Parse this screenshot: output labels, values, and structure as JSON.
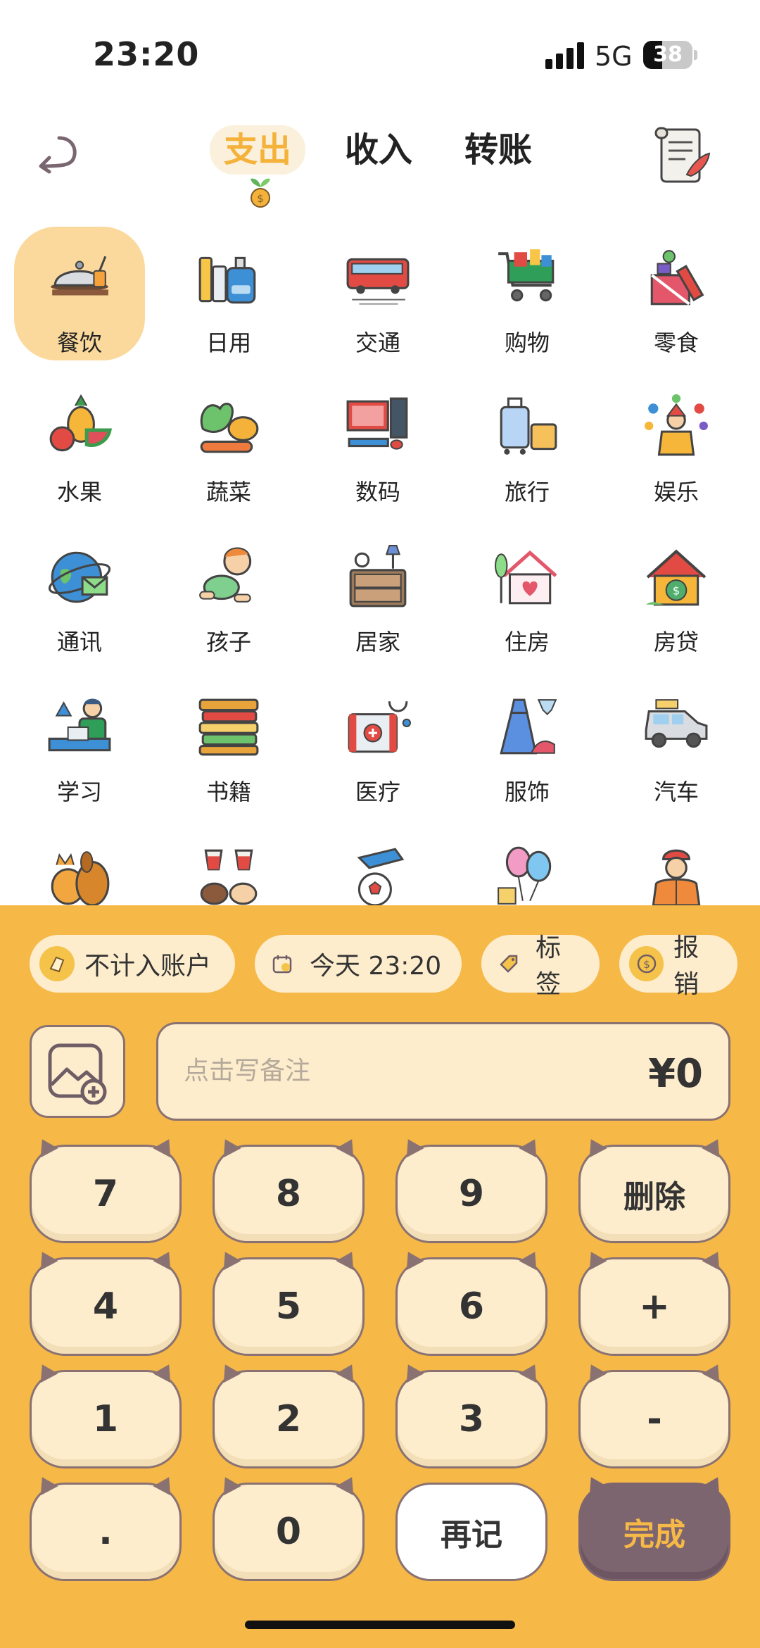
{
  "status": {
    "time": "23:20",
    "network": "5G",
    "battery": "38"
  },
  "header": {
    "back_icon": "undo-arrow-icon",
    "tabs": [
      {
        "label": "支出",
        "active": true
      },
      {
        "label": "收入",
        "active": false
      },
      {
        "label": "转账",
        "active": false
      }
    ],
    "bill_icon": "scroll-quill-icon"
  },
  "categories": [
    {
      "label": "餐饮",
      "icon": "dining-icon",
      "selected": true
    },
    {
      "label": "日用",
      "icon": "daily-use-icon"
    },
    {
      "label": "交通",
      "icon": "bus-icon"
    },
    {
      "label": "购物",
      "icon": "shopping-cart-icon"
    },
    {
      "label": "零食",
      "icon": "snack-gift-icon"
    },
    {
      "label": "水果",
      "icon": "fruit-icon"
    },
    {
      "label": "蔬菜",
      "icon": "vegetable-icon"
    },
    {
      "label": "数码",
      "icon": "computer-icon"
    },
    {
      "label": "旅行",
      "icon": "luggage-icon"
    },
    {
      "label": "娱乐",
      "icon": "juggler-icon"
    },
    {
      "label": "通讯",
      "icon": "globe-mail-icon"
    },
    {
      "label": "孩子",
      "icon": "baby-icon"
    },
    {
      "label": "居家",
      "icon": "cabinet-lamp-icon"
    },
    {
      "label": "住房",
      "icon": "house-heart-icon"
    },
    {
      "label": "房贷",
      "icon": "house-money-icon"
    },
    {
      "label": "学习",
      "icon": "study-icon"
    },
    {
      "label": "书籍",
      "icon": "books-icon"
    },
    {
      "label": "医疗",
      "icon": "medical-kit-icon"
    },
    {
      "label": "服饰",
      "icon": "dress-icon"
    },
    {
      "label": "汽车",
      "icon": "car-icon"
    },
    {
      "label": "",
      "icon": "pets-icon"
    },
    {
      "label": "",
      "icon": "toast-icon"
    },
    {
      "label": "",
      "icon": "sports-icon"
    },
    {
      "label": "",
      "icon": "balloons-icon"
    },
    {
      "label": "",
      "icon": "worker-icon"
    }
  ],
  "chips": [
    {
      "label": "不计入账户",
      "icon": "wallet-icon"
    },
    {
      "label": "今天 23:20",
      "icon": "calendar-icon"
    },
    {
      "label": "标签",
      "icon": "tag-icon"
    },
    {
      "label": "报销",
      "icon": "coin-icon"
    }
  ],
  "memo": {
    "placeholder": "点击写备注",
    "amount": "¥0",
    "image_icon": "add-image-icon"
  },
  "keypad": {
    "row1": [
      "7",
      "8",
      "9",
      "删除"
    ],
    "row2": [
      "4",
      "5",
      "6",
      "+"
    ],
    "row3": [
      "1",
      "2",
      "3",
      "-"
    ],
    "row4": [
      ".",
      "0",
      "再记",
      "完成"
    ]
  },
  "colors": {
    "accent": "#f6b846",
    "active_tab": "#f5b23a",
    "done": "#7d6570",
    "key": "#fdedcd"
  }
}
